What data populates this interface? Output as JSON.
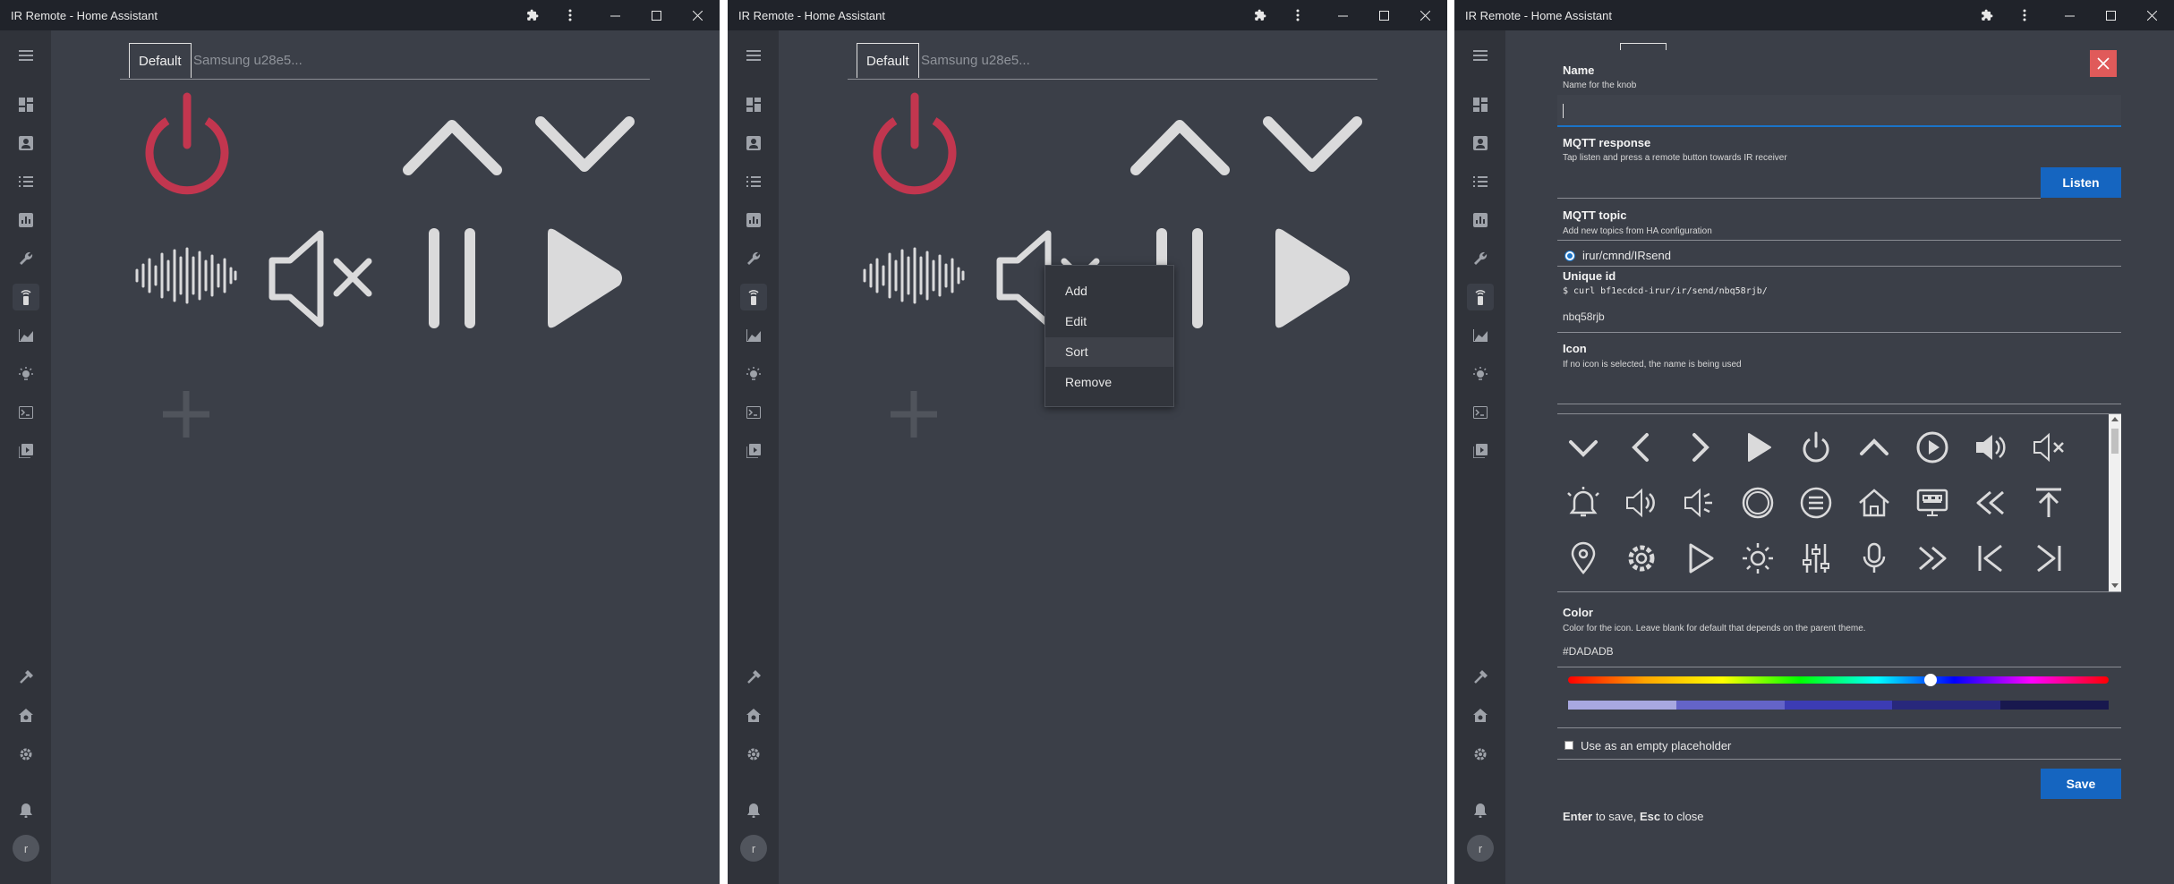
{
  "window": {
    "title": "IR Remote - Home Assistant"
  },
  "tabs": {
    "default": "Default",
    "samsung": "Samsung u28e5..."
  },
  "context_menu": {
    "items": [
      "Add",
      "Edit",
      "Sort",
      "Remove"
    ],
    "highlighted": "Sort"
  },
  "colors": {
    "background": "#3b3f48",
    "sidebar": "#30333a",
    "titlebar": "#20232a",
    "power": "#c2364f",
    "icon": "#dadadb",
    "accent": "#1565c0",
    "close": "#e05a5a"
  },
  "remote_buttons": [
    "power-icon",
    "chevron-up-icon",
    "chevron-down-icon",
    "waveform-icon",
    "mute-icon",
    "pause-icon",
    "play-icon",
    "add-icon"
  ],
  "dialog": {
    "name": {
      "label": "Name",
      "hint": "Name for the knob",
      "value": ""
    },
    "mqtt_response": {
      "label": "MQTT response",
      "hint": "Tap listen and press a remote button towards IR receiver",
      "value": "",
      "button": "Listen"
    },
    "mqtt_topic": {
      "label": "MQTT topic",
      "hint": "Add new topics from HA configuration",
      "option": "irur/cmnd/IRsend"
    },
    "unique_id": {
      "label": "Unique id",
      "command": "$ curl bf1ecdcd-irur/ir/send/nbq58rjb/",
      "value": "nbq58rjb"
    },
    "icon": {
      "label": "Icon",
      "hint": "If no icon is selected, the name is being used",
      "value": ""
    },
    "color": {
      "label": "Color",
      "hint": "Color for the icon. Leave blank for default that depends on the parent theme.",
      "value": "#DADADB",
      "hue_position": 0.67
    },
    "placeholder_checkbox": {
      "label": "Use as an empty placeholder",
      "checked": false
    },
    "save_button": "Save",
    "footer": {
      "enter": "Enter",
      "to_save": " to save, ",
      "esc": "Esc",
      "to_close": " to close"
    }
  }
}
